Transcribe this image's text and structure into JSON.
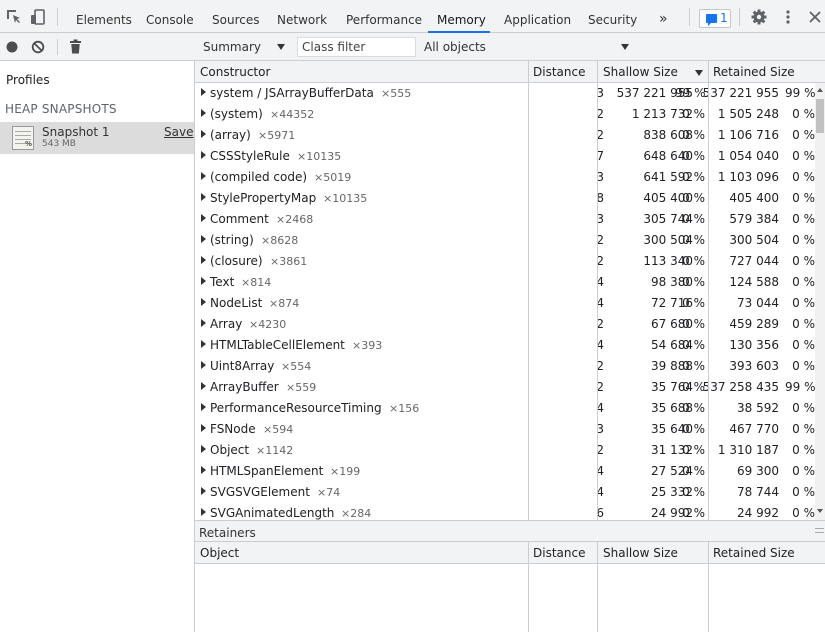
{
  "toolbar": {
    "tabs": [
      {
        "label": "Elements"
      },
      {
        "label": "Console"
      },
      {
        "label": "Sources"
      },
      {
        "label": "Network"
      },
      {
        "label": "Performance"
      },
      {
        "label": "Memory"
      },
      {
        "label": "Application"
      },
      {
        "label": "Security"
      }
    ],
    "active_tab": "Memory",
    "more_glyph": "»",
    "issues_count": "1",
    "accent_color": "#1a73e8"
  },
  "sidebar": {
    "title": "Profiles",
    "section": "HEAP SNAPSHOTS",
    "snapshot": {
      "name": "Snapshot 1",
      "size": "543 MB",
      "save_label": "Save"
    }
  },
  "main_toolbar": {
    "view": "Summary",
    "filter_placeholder": "Class filter",
    "objects": "All objects"
  },
  "grid": {
    "columns": {
      "constructor": "Constructor",
      "distance": "Distance",
      "shallow": "Shallow Size",
      "retained": "Retained Size"
    },
    "rows": [
      {
        "name": "system / JSArrayBufferData",
        "count": "×555",
        "distance": "3",
        "shallow": "537 221 955",
        "shallow_pct": "99 %",
        "retained": "537 221 955",
        "retained_pct": "99 %"
      },
      {
        "name": "(system)",
        "count": "×44352",
        "distance": "2",
        "shallow": "1 213 732",
        "shallow_pct": "0 %",
        "retained": "1 505 248",
        "retained_pct": "0 %"
      },
      {
        "name": "(array)",
        "count": "×5971",
        "distance": "2",
        "shallow": "838 608",
        "shallow_pct": "0 %",
        "retained": "1 106 716",
        "retained_pct": "0 %"
      },
      {
        "name": "CSSStyleRule",
        "count": "×10135",
        "distance": "7",
        "shallow": "648 640",
        "shallow_pct": "0 %",
        "retained": "1 054 040",
        "retained_pct": "0 %"
      },
      {
        "name": "(compiled code)",
        "count": "×5019",
        "distance": "3",
        "shallow": "641 592",
        "shallow_pct": "0 %",
        "retained": "1 103 096",
        "retained_pct": "0 %"
      },
      {
        "name": "StylePropertyMap",
        "count": "×10135",
        "distance": "8",
        "shallow": "405 400",
        "shallow_pct": "0 %",
        "retained": "405 400",
        "retained_pct": "0 %"
      },
      {
        "name": "Comment",
        "count": "×2468",
        "distance": "3",
        "shallow": "305 744",
        "shallow_pct": "0 %",
        "retained": "579 384",
        "retained_pct": "0 %"
      },
      {
        "name": "(string)",
        "count": "×8628",
        "distance": "2",
        "shallow": "300 504",
        "shallow_pct": "0 %",
        "retained": "300 504",
        "retained_pct": "0 %"
      },
      {
        "name": "(closure)",
        "count": "×3861",
        "distance": "2",
        "shallow": "113 340",
        "shallow_pct": "0 %",
        "retained": "727 044",
        "retained_pct": "0 %"
      },
      {
        "name": "Text",
        "count": "×814",
        "distance": "4",
        "shallow": "98 380",
        "shallow_pct": "0 %",
        "retained": "124 588",
        "retained_pct": "0 %"
      },
      {
        "name": "NodeList",
        "count": "×874",
        "distance": "4",
        "shallow": "72 716",
        "shallow_pct": "0 %",
        "retained": "73 044",
        "retained_pct": "0 %"
      },
      {
        "name": "Array",
        "count": "×4230",
        "distance": "2",
        "shallow": "67 680",
        "shallow_pct": "0 %",
        "retained": "459 289",
        "retained_pct": "0 %"
      },
      {
        "name": "HTMLTableCellElement",
        "count": "×393",
        "distance": "4",
        "shallow": "54 684",
        "shallow_pct": "0 %",
        "retained": "130 356",
        "retained_pct": "0 %"
      },
      {
        "name": "Uint8Array",
        "count": "×554",
        "distance": "2",
        "shallow": "39 888",
        "shallow_pct": "0 %",
        "retained": "393 603",
        "retained_pct": "0 %"
      },
      {
        "name": "ArrayBuffer",
        "count": "×559",
        "distance": "2",
        "shallow": "35 764",
        "shallow_pct": "0 %",
        "retained": "537 258 435",
        "retained_pct": "99 %"
      },
      {
        "name": "PerformanceResourceTiming",
        "count": "×156",
        "distance": "4",
        "shallow": "35 688",
        "shallow_pct": "0 %",
        "retained": "38 592",
        "retained_pct": "0 %"
      },
      {
        "name": "FSNode",
        "count": "×594",
        "distance": "3",
        "shallow": "35 640",
        "shallow_pct": "0 %",
        "retained": "467 770",
        "retained_pct": "0 %"
      },
      {
        "name": "Object",
        "count": "×1142",
        "distance": "2",
        "shallow": "31 132",
        "shallow_pct": "0 %",
        "retained": "1 310 187",
        "retained_pct": "0 %"
      },
      {
        "name": "HTMLSpanElement",
        "count": "×199",
        "distance": "4",
        "shallow": "27 524",
        "shallow_pct": "0 %",
        "retained": "69 300",
        "retained_pct": "0 %"
      },
      {
        "name": "SVGSVGElement",
        "count": "×74",
        "distance": "4",
        "shallow": "25 332",
        "shallow_pct": "0 %",
        "retained": "78 744",
        "retained_pct": "0 %"
      },
      {
        "name": "SVGAnimatedLength",
        "count": "×284",
        "distance": "6",
        "shallow": "24 992",
        "shallow_pct": "0 %",
        "retained": "24 992",
        "retained_pct": "0 %"
      }
    ]
  },
  "retainers": {
    "title": "Retainers",
    "columns": {
      "object": "Object",
      "distance": "Distance",
      "shallow": "Shallow Size",
      "retained": "Retained Size"
    }
  },
  "icons": [
    "inspect-element-icon",
    "device-toggle-icon",
    "issues-message-icon",
    "gear-icon",
    "kebab-menu-icon",
    "close-icon",
    "record-icon",
    "clear-icon",
    "trash-icon",
    "snapshot-icon"
  ]
}
